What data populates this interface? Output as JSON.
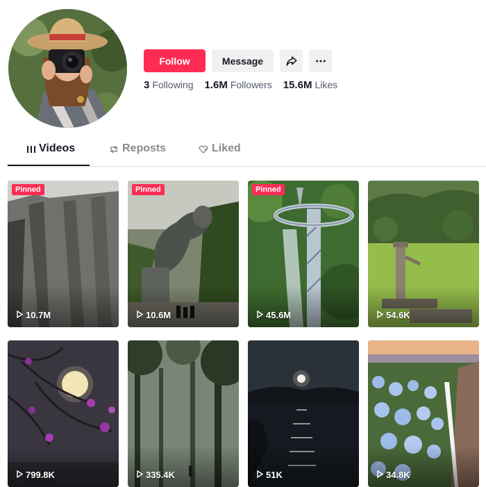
{
  "profile": {
    "follow_label": "Follow",
    "message_label": "Message",
    "stats": {
      "following_count": "3",
      "following_label": "Following",
      "followers_count": "1.6M",
      "followers_label": "Followers",
      "likes_count": "15.6M",
      "likes_label": "Likes"
    }
  },
  "tabs": [
    {
      "label": "Videos",
      "icon": "grid-icon"
    },
    {
      "label": "Reposts",
      "icon": "repost-icon"
    },
    {
      "label": "Liked",
      "icon": "heart-icon"
    }
  ],
  "pinned_label": "Pinned",
  "videos": [
    {
      "views": "10.7M",
      "pinned": true
    },
    {
      "views": "10.6M",
      "pinned": true
    },
    {
      "views": "45.6M",
      "pinned": true
    },
    {
      "views": "54.6K",
      "pinned": false
    },
    {
      "views": "799.8K",
      "pinned": false
    },
    {
      "views": "335.4K",
      "pinned": false
    },
    {
      "views": "51K",
      "pinned": false
    },
    {
      "views": "34.8K",
      "pinned": false
    }
  ],
  "colors": {
    "accent": "#fe2c55",
    "text_primary": "#161823",
    "text_secondary": "#8a8b91",
    "button_secondary_bg": "#f1f1f2"
  }
}
